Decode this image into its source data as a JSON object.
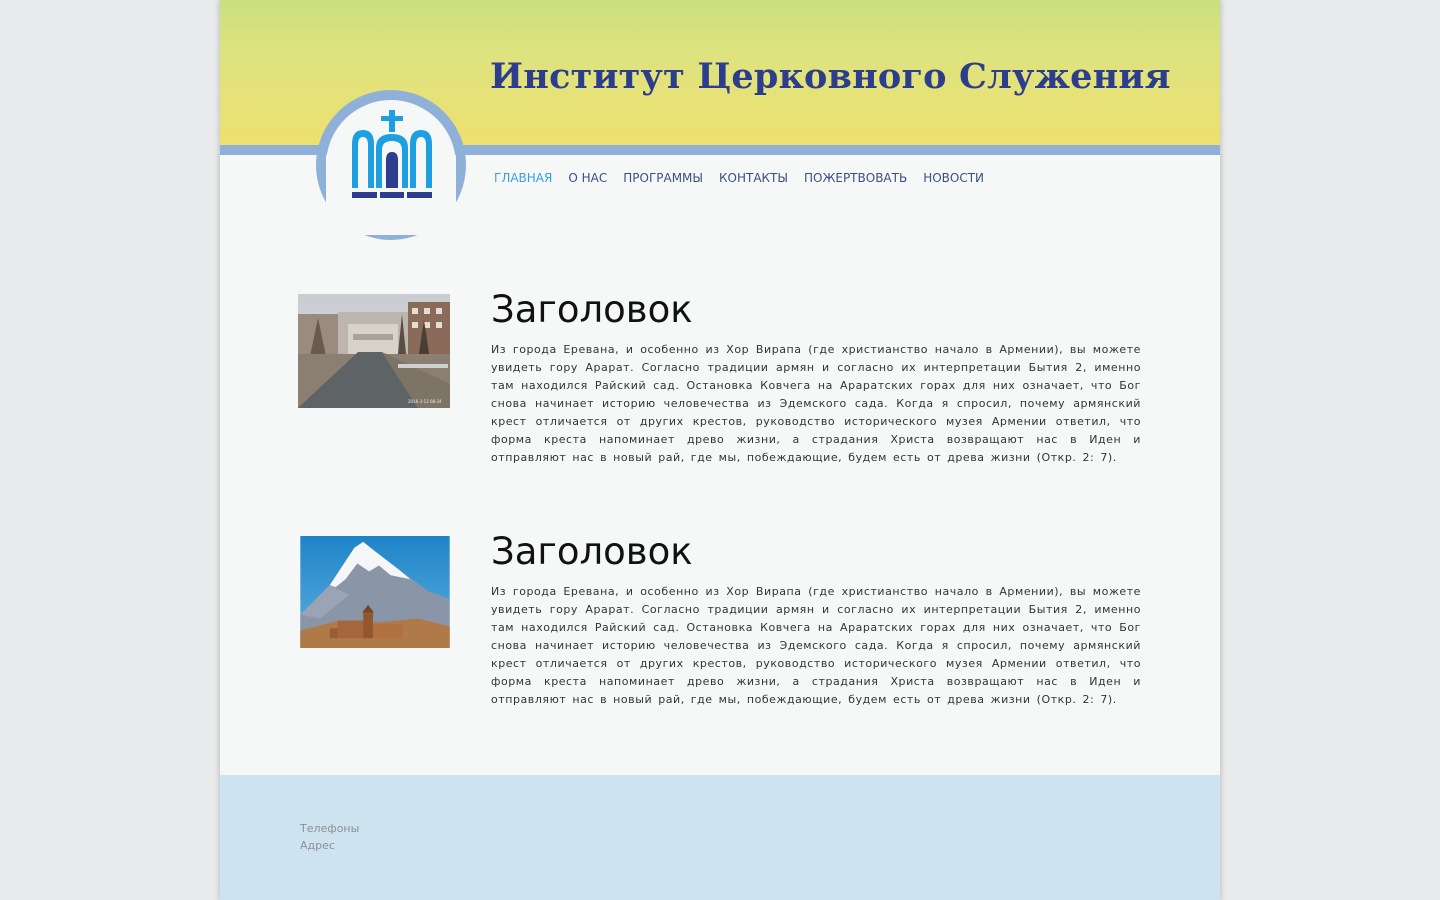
{
  "site": {
    "title": "Институт Церковного Служения",
    "logo_icon": "church-arches-cross-icon"
  },
  "nav": {
    "items": [
      {
        "label": "ГЛАВНАЯ",
        "active": true
      },
      {
        "label": "О НАС",
        "active": false
      },
      {
        "label": "ПРОГРАММЫ",
        "active": false
      },
      {
        "label": "КОНТАКТЫ",
        "active": false
      },
      {
        "label": "ПОЖЕРТВОВАТЬ",
        "active": false
      },
      {
        "label": "НОВОСТИ",
        "active": false
      }
    ]
  },
  "articles": [
    {
      "heading": "Заголовок",
      "text": "Из города Еревана, и особенно из Хор Вирапа (где христианство начало в Армении), вы можете увидеть гору Арарат. Согласно традиции армян и согласно их интерпретации Бытия 2, именно там находился Райский сад. Остановка Ковчега на Араратских горах для них означает, что Бог снова начинает историю человечества из Эдемского сада. Когда я спросил, почему армянский крест отличается от других крестов, руководство исторического музея Армении ответил, что форма креста напоминает древо жизни, а страдания Христа возвращают нас в Иден и отправляют нас в новый рай, где мы, побеждающие, будем есть от древа жизни (Откр. 2: 7).",
      "image": "yerevan-cascade-photo",
      "photo_stamp": "2016-3-13 08:34"
    },
    {
      "heading": "Заголовок",
      "text": "Из города Еревана, и особенно из Хор Вирапа (где христианство начало в Армении), вы можете увидеть гору Арарат. Согласно традиции армян и согласно их интерпретации Бытия 2, именно там находился Райский сад. Остановка Ковчега на Араратских горах для них означает, что Бог снова начинает историю человечества из Эдемского сада. Когда я спросил, почему армянский крест отличается от других крестов, руководство исторического музея Армении ответил, что форма креста напоминает древо жизни, а страдания Христа возвращают нас в Иден и отправляют нас в новый рай, где мы, побеждающие, будем есть от древа жизни (Откр. 2: 7).",
      "image": "mount-ararat-khor-virap-photo"
    }
  ],
  "footer": {
    "phones_label": "Телефоны",
    "address_label": "Адрес"
  },
  "colors": {
    "title": "#2b3d8c",
    "nav": "#3b4f80",
    "nav_active": "#36a0e0",
    "header_top": "#c9e07e",
    "header_bottom": "#ede070",
    "stripe": "#8fb0d8",
    "footer_bg": "#cde3f0",
    "logo_blue": "#1ea0e0",
    "logo_navy": "#2b3d8c"
  }
}
